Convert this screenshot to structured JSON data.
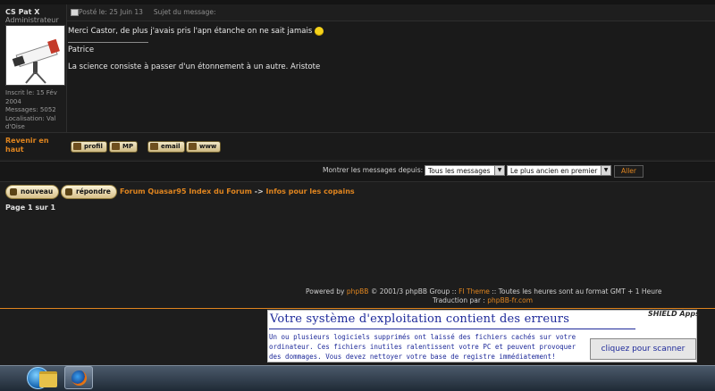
{
  "post": {
    "username": "CS Pat X",
    "rank": "Administrateur",
    "profile_info": [
      "Inscrit le: 15 Fév",
      "2004",
      "Messages: 5052",
      "Localisation: Val",
      "d'Oise"
    ],
    "meta": "Posté le: 25 Juin 13     Sujet du message:",
    "message": "Merci Castor, de plus j'avais pris l'apn étanche on ne sait jamais",
    "signature_name": "Patrice",
    "signature_quote": "La science consiste à passer d'un étonnement à un autre. Aristote",
    "back_to_top": "Revenir en haut",
    "buttons": {
      "profile": "profil",
      "pm": "MP",
      "email": "email",
      "www": "www"
    }
  },
  "sort": {
    "label": "Montrer les messages depuis:",
    "period_value": "Tous les messages",
    "order_value": "Le plus ancien en premier",
    "go_label": "Aller"
  },
  "actions": {
    "new_topic": "nouveau",
    "reply": "répondre"
  },
  "breadcrumb": {
    "forum_index": "Forum Quasar95 Index du Forum",
    "separator": "->",
    "topic": "Infos pour les copains"
  },
  "pagination": {
    "text": "Page 1 sur 1"
  },
  "footer": {
    "powered_by": "Powered by",
    "phpbb": "phpBB",
    "copyright": "© 2001/3 phpBB Group ::",
    "theme": "FI Theme",
    "timezone": ":: Toutes les heures sont au format GMT + 1 Heure",
    "translation": "Traduction par :",
    "translator": "phpBB-fr.com"
  },
  "ad": {
    "title": "Votre système d'exploitation contient des erreurs",
    "brand": "SHIELD Apps",
    "text": "Un ou plusieurs logiciels supprimés ont laissé des fichiers cachés sur votre ordinateur. Ces fichiers inutiles ralentissent votre PC et peuvent provoquer des dommages. Vous devez nettoyer votre base de registre immédiatement!",
    "button": "cliquez pour scanner"
  },
  "colors": {
    "accent": "#e0851f",
    "background": "#1d1d1d",
    "ad_text": "#1e2a9a"
  }
}
